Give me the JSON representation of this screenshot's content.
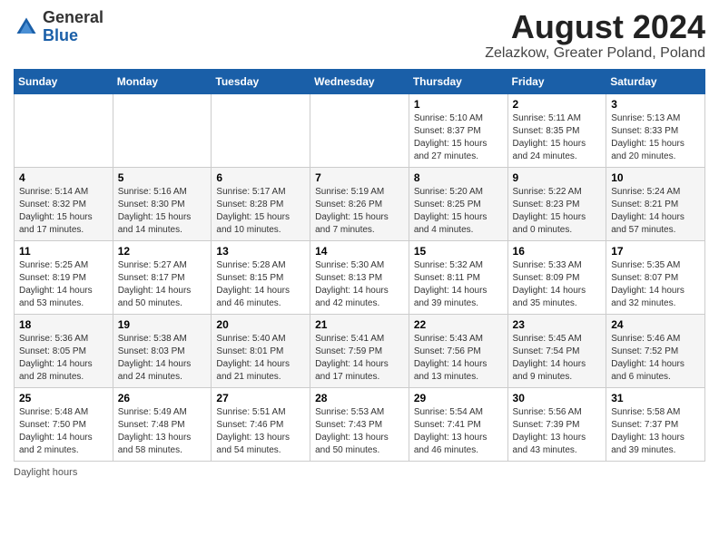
{
  "header": {
    "logo_general": "General",
    "logo_blue": "Blue",
    "month_title": "August 2024",
    "location": "Zelazkow, Greater Poland, Poland"
  },
  "weekdays": [
    "Sunday",
    "Monday",
    "Tuesday",
    "Wednesday",
    "Thursday",
    "Friday",
    "Saturday"
  ],
  "footer": {
    "note": "Daylight hours"
  },
  "weeks": [
    [
      {
        "day": "",
        "info": ""
      },
      {
        "day": "",
        "info": ""
      },
      {
        "day": "",
        "info": ""
      },
      {
        "day": "",
        "info": ""
      },
      {
        "day": "1",
        "info": "Sunrise: 5:10 AM\nSunset: 8:37 PM\nDaylight: 15 hours\nand 27 minutes."
      },
      {
        "day": "2",
        "info": "Sunrise: 5:11 AM\nSunset: 8:35 PM\nDaylight: 15 hours\nand 24 minutes."
      },
      {
        "day": "3",
        "info": "Sunrise: 5:13 AM\nSunset: 8:33 PM\nDaylight: 15 hours\nand 20 minutes."
      }
    ],
    [
      {
        "day": "4",
        "info": "Sunrise: 5:14 AM\nSunset: 8:32 PM\nDaylight: 15 hours\nand 17 minutes."
      },
      {
        "day": "5",
        "info": "Sunrise: 5:16 AM\nSunset: 8:30 PM\nDaylight: 15 hours\nand 14 minutes."
      },
      {
        "day": "6",
        "info": "Sunrise: 5:17 AM\nSunset: 8:28 PM\nDaylight: 15 hours\nand 10 minutes."
      },
      {
        "day": "7",
        "info": "Sunrise: 5:19 AM\nSunset: 8:26 PM\nDaylight: 15 hours\nand 7 minutes."
      },
      {
        "day": "8",
        "info": "Sunrise: 5:20 AM\nSunset: 8:25 PM\nDaylight: 15 hours\nand 4 minutes."
      },
      {
        "day": "9",
        "info": "Sunrise: 5:22 AM\nSunset: 8:23 PM\nDaylight: 15 hours\nand 0 minutes."
      },
      {
        "day": "10",
        "info": "Sunrise: 5:24 AM\nSunset: 8:21 PM\nDaylight: 14 hours\nand 57 minutes."
      }
    ],
    [
      {
        "day": "11",
        "info": "Sunrise: 5:25 AM\nSunset: 8:19 PM\nDaylight: 14 hours\nand 53 minutes."
      },
      {
        "day": "12",
        "info": "Sunrise: 5:27 AM\nSunset: 8:17 PM\nDaylight: 14 hours\nand 50 minutes."
      },
      {
        "day": "13",
        "info": "Sunrise: 5:28 AM\nSunset: 8:15 PM\nDaylight: 14 hours\nand 46 minutes."
      },
      {
        "day": "14",
        "info": "Sunrise: 5:30 AM\nSunset: 8:13 PM\nDaylight: 14 hours\nand 42 minutes."
      },
      {
        "day": "15",
        "info": "Sunrise: 5:32 AM\nSunset: 8:11 PM\nDaylight: 14 hours\nand 39 minutes."
      },
      {
        "day": "16",
        "info": "Sunrise: 5:33 AM\nSunset: 8:09 PM\nDaylight: 14 hours\nand 35 minutes."
      },
      {
        "day": "17",
        "info": "Sunrise: 5:35 AM\nSunset: 8:07 PM\nDaylight: 14 hours\nand 32 minutes."
      }
    ],
    [
      {
        "day": "18",
        "info": "Sunrise: 5:36 AM\nSunset: 8:05 PM\nDaylight: 14 hours\nand 28 minutes."
      },
      {
        "day": "19",
        "info": "Sunrise: 5:38 AM\nSunset: 8:03 PM\nDaylight: 14 hours\nand 24 minutes."
      },
      {
        "day": "20",
        "info": "Sunrise: 5:40 AM\nSunset: 8:01 PM\nDaylight: 14 hours\nand 21 minutes."
      },
      {
        "day": "21",
        "info": "Sunrise: 5:41 AM\nSunset: 7:59 PM\nDaylight: 14 hours\nand 17 minutes."
      },
      {
        "day": "22",
        "info": "Sunrise: 5:43 AM\nSunset: 7:56 PM\nDaylight: 14 hours\nand 13 minutes."
      },
      {
        "day": "23",
        "info": "Sunrise: 5:45 AM\nSunset: 7:54 PM\nDaylight: 14 hours\nand 9 minutes."
      },
      {
        "day": "24",
        "info": "Sunrise: 5:46 AM\nSunset: 7:52 PM\nDaylight: 14 hours\nand 6 minutes."
      }
    ],
    [
      {
        "day": "25",
        "info": "Sunrise: 5:48 AM\nSunset: 7:50 PM\nDaylight: 14 hours\nand 2 minutes."
      },
      {
        "day": "26",
        "info": "Sunrise: 5:49 AM\nSunset: 7:48 PM\nDaylight: 13 hours\nand 58 minutes."
      },
      {
        "day": "27",
        "info": "Sunrise: 5:51 AM\nSunset: 7:46 PM\nDaylight: 13 hours\nand 54 minutes."
      },
      {
        "day": "28",
        "info": "Sunrise: 5:53 AM\nSunset: 7:43 PM\nDaylight: 13 hours\nand 50 minutes."
      },
      {
        "day": "29",
        "info": "Sunrise: 5:54 AM\nSunset: 7:41 PM\nDaylight: 13 hours\nand 46 minutes."
      },
      {
        "day": "30",
        "info": "Sunrise: 5:56 AM\nSunset: 7:39 PM\nDaylight: 13 hours\nand 43 minutes."
      },
      {
        "day": "31",
        "info": "Sunrise: 5:58 AM\nSunset: 7:37 PM\nDaylight: 13 hours\nand 39 minutes."
      }
    ]
  ]
}
